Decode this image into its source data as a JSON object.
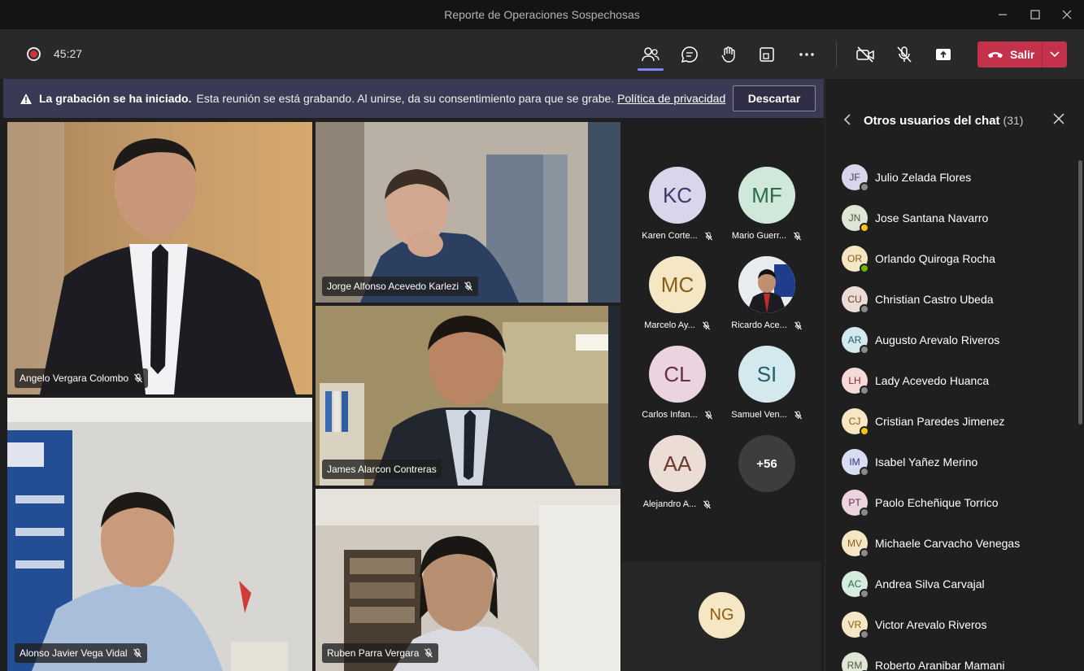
{
  "window": {
    "title": "Reporte de Operaciones Sospechosas"
  },
  "toolbar": {
    "timer": "45:27",
    "leave_label": "Salir"
  },
  "banner": {
    "bold_text": "La grabación se ha iniciado.",
    "message": "Esta reunión se está grabando. Al unirse, da su consentimiento para que se grabe.",
    "link": "Política de privacidad",
    "dismiss_label": "Descartar"
  },
  "videos": [
    {
      "name": "Angelo Vergara Colombo"
    },
    {
      "name": "Jorge Alfonso Acevedo Karlezi"
    },
    {
      "name": "James Alarcon Contreras"
    },
    {
      "name": "Alonso Javier Vega Vidal"
    },
    {
      "name": "Ruben Parra Vergara"
    }
  ],
  "roster": [
    {
      "initials": "KC",
      "name": "Karen Corte...",
      "bg": "#d9d6ec",
      "fg": "#3b3a6b"
    },
    {
      "initials": "MF",
      "name": "Mario Guerr...",
      "bg": "#cfe8d9",
      "fg": "#2b6b4a"
    },
    {
      "initials": "MC",
      "name": "Marcelo Ay...",
      "bg": "#f5e6c4",
      "fg": "#8a5d16"
    },
    {
      "initials": "",
      "name": "Ricardo Ace...",
      "bg": "#dfe3ea",
      "fg": "#333"
    },
    {
      "initials": "CL",
      "name": "Carlos Infan...",
      "bg": "#ecd3e0",
      "fg": "#6b2d4a"
    },
    {
      "initials": "SI",
      "name": "Samuel Ven...",
      "bg": "#d3e9ee",
      "fg": "#235c6b"
    },
    {
      "initials": "AA",
      "name": "Alejandro A...",
      "bg": "#ecdcd6",
      "fg": "#6b3a2b"
    },
    {
      "initials": "+56",
      "name": "",
      "bg": "#3d3d3d",
      "fg": "#ffffff"
    }
  ],
  "extra_participant": {
    "initials": "NG",
    "bg": "#f5e6c4",
    "fg": "#8a5d16"
  },
  "panel": {
    "title": "Otros usuarios del chat",
    "count": "(31)",
    "users": [
      {
        "initials": "JF",
        "name": "Julio Zelada Flores",
        "bg": "#d9d6ec",
        "fg": "#3b3a6b",
        "status": "#8a8a8a"
      },
      {
        "initials": "JN",
        "name": "Jose Santana Navarro",
        "bg": "#dfe6d6",
        "fg": "#4d5b3a",
        "status": "#f8c21b"
      },
      {
        "initials": "OR",
        "name": "Orlando Quiroga Rocha",
        "bg": "#f5e6c4",
        "fg": "#8a5d16",
        "status": "#6bb700"
      },
      {
        "initials": "CU",
        "name": "Christian Castro Ubeda",
        "bg": "#ecdcd6",
        "fg": "#6b3a2b",
        "status": "#8a8a8a"
      },
      {
        "initials": "AR",
        "name": "Augusto Arevalo Riveros",
        "bg": "#d3e9ee",
        "fg": "#235c6b",
        "status": "#8a8a8a"
      },
      {
        "initials": "LH",
        "name": "Lady Acevedo Huanca",
        "bg": "#f6d9d9",
        "fg": "#7a2b2b",
        "status": "#8a8a8a"
      },
      {
        "initials": "CJ",
        "name": "Cristian Paredes Jimenez",
        "bg": "#f5e6c4",
        "fg": "#8a5d16",
        "status": "#f8c21b"
      },
      {
        "initials": "IM",
        "name": "Isabel Yañez Merino",
        "bg": "#d9dcf2",
        "fg": "#33397a",
        "status": "#8a8a8a"
      },
      {
        "initials": "PT",
        "name": "Paolo Echeñique Torrico",
        "bg": "#ecd3e0",
        "fg": "#6b2d4a",
        "status": "#8a8a8a"
      },
      {
        "initials": "MV",
        "name": "Michaele Carvacho Venegas",
        "bg": "#f5e6c4",
        "fg": "#8a5d16",
        "status": "#8a8a8a"
      },
      {
        "initials": "AC",
        "name": "Andrea Silva Carvajal",
        "bg": "#d6ecdf",
        "fg": "#2b6b4a",
        "status": "#8a8a8a"
      },
      {
        "initials": "VR",
        "name": "Victor Arevalo Riveros",
        "bg": "#f5e6c4",
        "fg": "#8a5d16",
        "status": "#8a8a8a"
      },
      {
        "initials": "RM",
        "name": "Roberto Aranibar Mamani",
        "bg": "#dfe6d6",
        "fg": "#4d5b3a",
        "status": "#8a8a8a"
      }
    ]
  }
}
